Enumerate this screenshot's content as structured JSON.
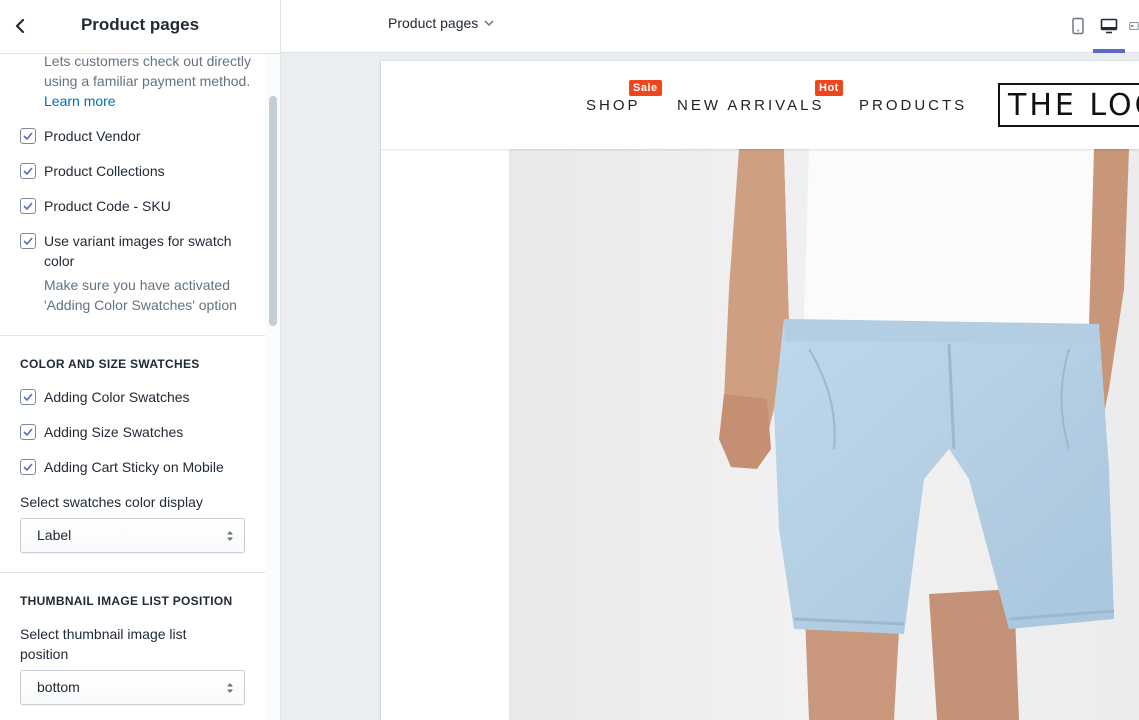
{
  "sidebar": {
    "title": "Product pages",
    "help_text_1": "Lets customers check out directly using a familiar payment method. ",
    "learn_more": "Learn more",
    "checkboxes_top": [
      {
        "label": "Product Vendor",
        "checked": true
      },
      {
        "label": "Product Collections",
        "checked": true
      },
      {
        "label": "Product Code - SKU",
        "checked": true
      },
      {
        "label": "Use variant images for swatch color",
        "checked": true
      }
    ],
    "help_text_2": "Make sure you have activated 'Adding Color Swatches' option",
    "section_swatches": "COLOR AND SIZE SWATCHES",
    "checkboxes_swatches": [
      {
        "label": "Adding Color Swatches",
        "checked": true
      },
      {
        "label": "Adding Size Swatches",
        "checked": true
      },
      {
        "label": "Adding Cart Sticky on Mobile",
        "checked": true
      }
    ],
    "swatch_display_label": "Select swatches color display",
    "swatch_display_value": "Label",
    "section_thumbnail": "THUMBNAIL IMAGE LIST POSITION",
    "thumbnail_label": "Select thumbnail image list position",
    "thumbnail_value": "bottom"
  },
  "topbar": {
    "page_select": "Product pages",
    "devices": [
      "mobile-icon",
      "desktop-icon",
      "fullscreen-icon"
    ],
    "active_device": "desktop"
  },
  "preview": {
    "nav": [
      {
        "label": "SHOP",
        "badge": "Sale"
      },
      {
        "label": "NEW ARRIVALS",
        "badge": "Hot"
      },
      {
        "label": "PRODUCTS",
        "badge": ""
      }
    ],
    "logo": "THE LOGO",
    "colors": {
      "accent": "#5c6ac4",
      "badge": "#f0461d",
      "link": "#006fbb"
    }
  }
}
